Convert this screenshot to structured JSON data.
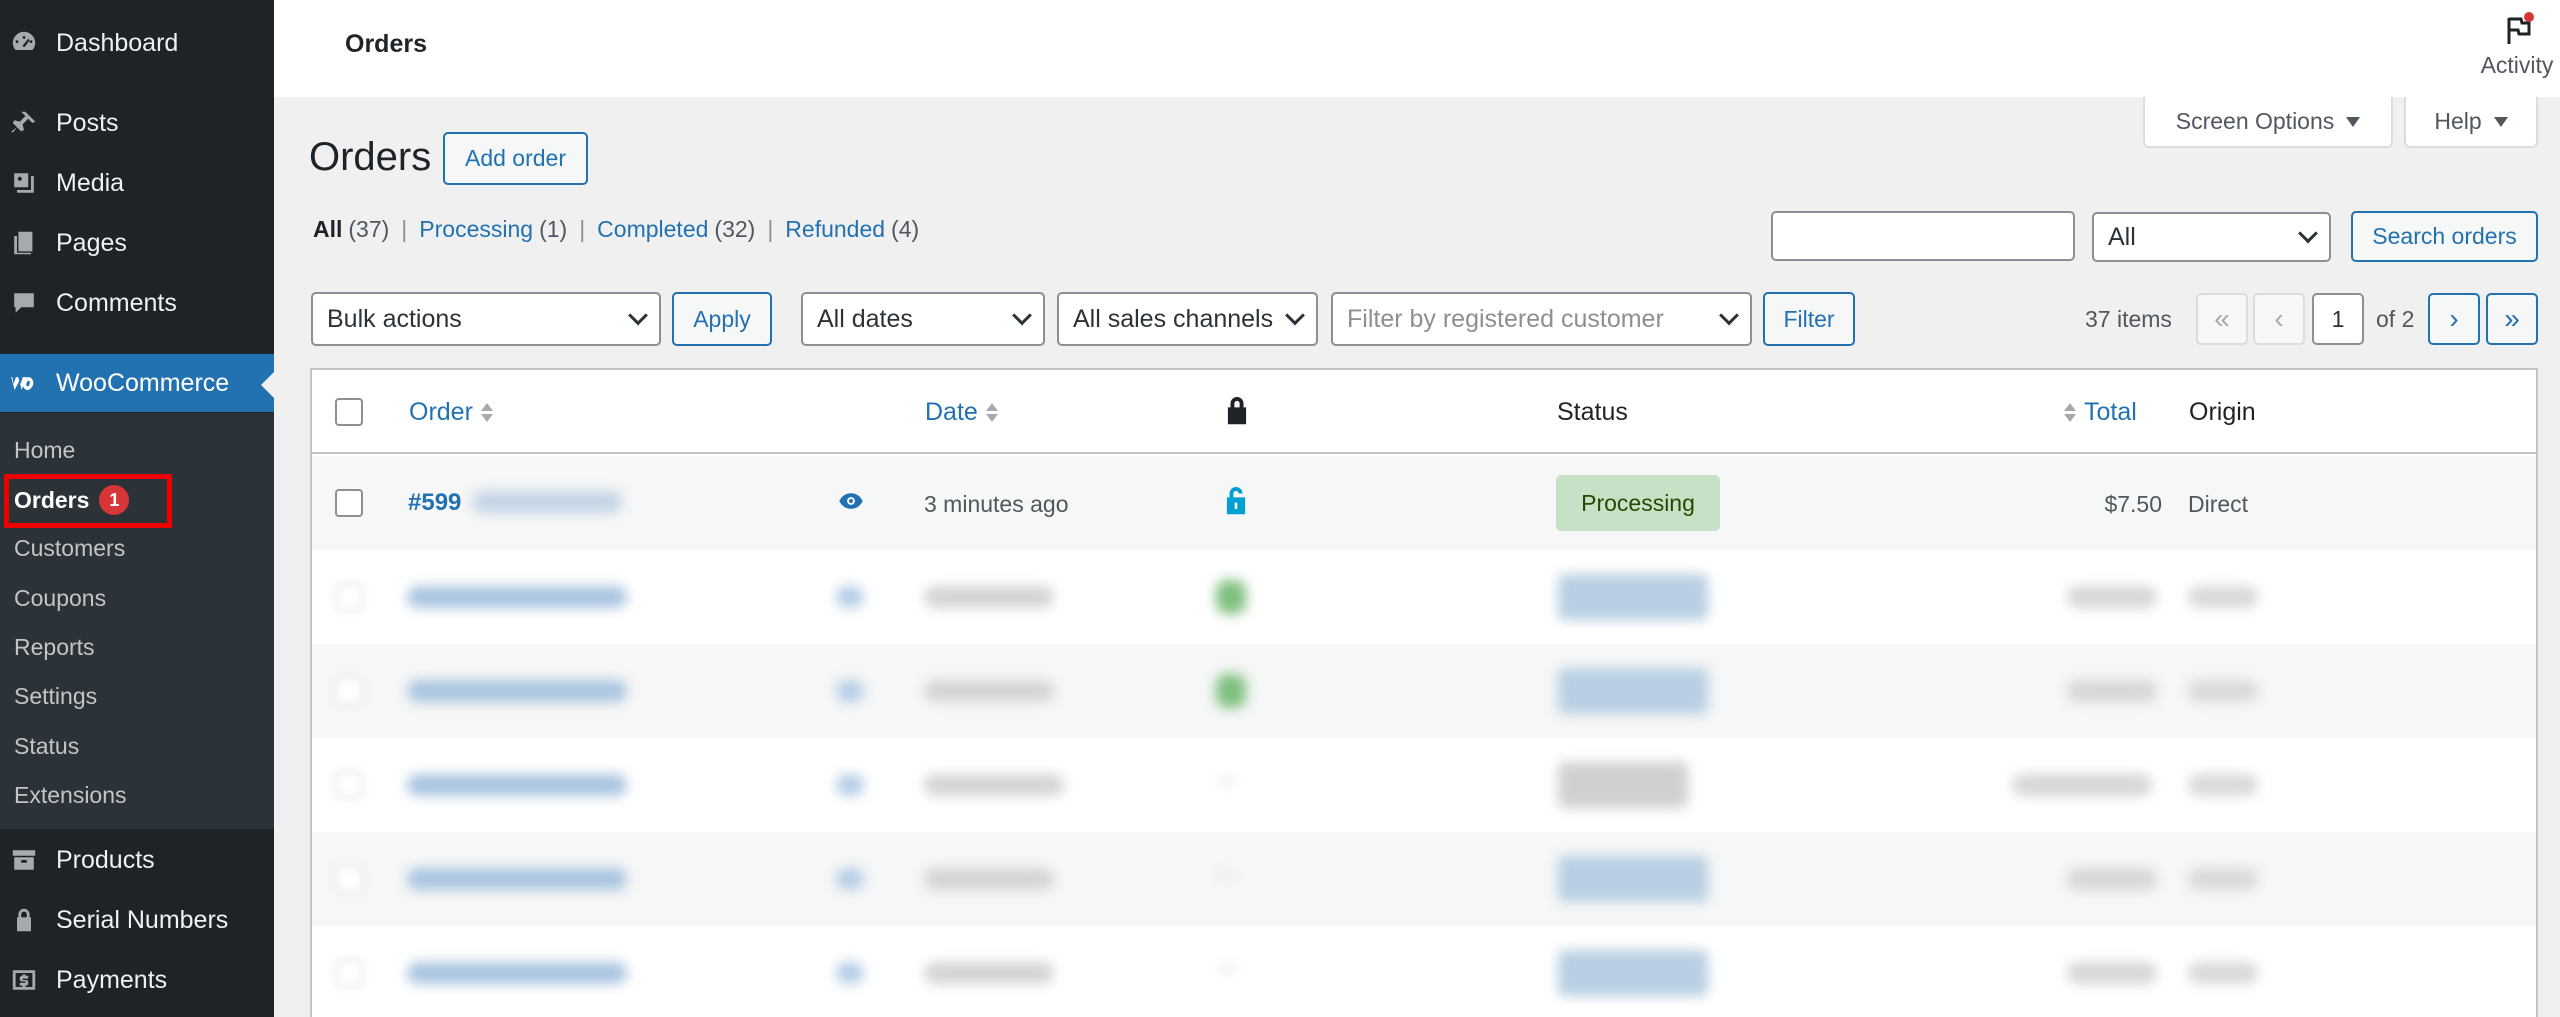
{
  "sidebar": {
    "items": [
      {
        "label": "Dashboard",
        "icon": "dashboard-icon"
      },
      {
        "label": "Posts",
        "icon": "pin-icon"
      },
      {
        "label": "Media",
        "icon": "media-icon"
      },
      {
        "label": "Pages",
        "icon": "pages-icon"
      },
      {
        "label": "Comments",
        "icon": "comments-icon"
      },
      {
        "label": "WooCommerce",
        "icon": "woocommerce-icon"
      },
      {
        "label": "Products",
        "icon": "archive-icon"
      },
      {
        "label": "Serial Numbers",
        "icon": "lock-icon"
      },
      {
        "label": "Payments",
        "icon": "dollar-icon"
      }
    ],
    "woo_submenu": {
      "home": "Home",
      "orders": "Orders",
      "orders_badge": "1",
      "customers": "Customers",
      "coupons": "Coupons",
      "reports": "Reports",
      "settings": "Settings",
      "status": "Status",
      "extensions": "Extensions"
    }
  },
  "header": {
    "title": "Orders",
    "activity": "Activity"
  },
  "screen_options": "Screen Options",
  "help": "Help",
  "page": {
    "title": "Orders",
    "add_order": "Add order"
  },
  "filters_links": {
    "all": "All",
    "all_count": "(37)",
    "processing": "Processing",
    "processing_count": "(1)",
    "completed": "Completed",
    "completed_count": "(32)",
    "refunded": "Refunded",
    "refunded_count": "(4)",
    "separator": "|"
  },
  "search": {
    "value": "",
    "type_selected": "All",
    "button": "Search orders"
  },
  "toolbar": {
    "bulk_actions": "Bulk actions",
    "apply": "Apply",
    "dates": "All dates",
    "channels": "All sales channels",
    "customer_placeholder": "Filter by registered customer",
    "filter": "Filter",
    "items_count": "37 items",
    "first_page": "«",
    "prev_page": "‹",
    "current_page": "1",
    "of_pages": "of 2",
    "next_page": "›",
    "last_page": "»"
  },
  "table": {
    "headers": {
      "order": "Order",
      "date": "Date",
      "status": "Status",
      "total": "Total",
      "origin": "Origin"
    },
    "rows": [
      {
        "order": "#599",
        "date": "3 minutes ago",
        "status": "Processing",
        "total": "$7.50",
        "origin": "Direct"
      }
    ]
  },
  "colors": {
    "sidebar_bg": "#1d2327",
    "accent": "#2271b1",
    "processing_bg": "#c6e1c6",
    "processing_text": "#2c4700",
    "highlight_box": "#e00000"
  }
}
